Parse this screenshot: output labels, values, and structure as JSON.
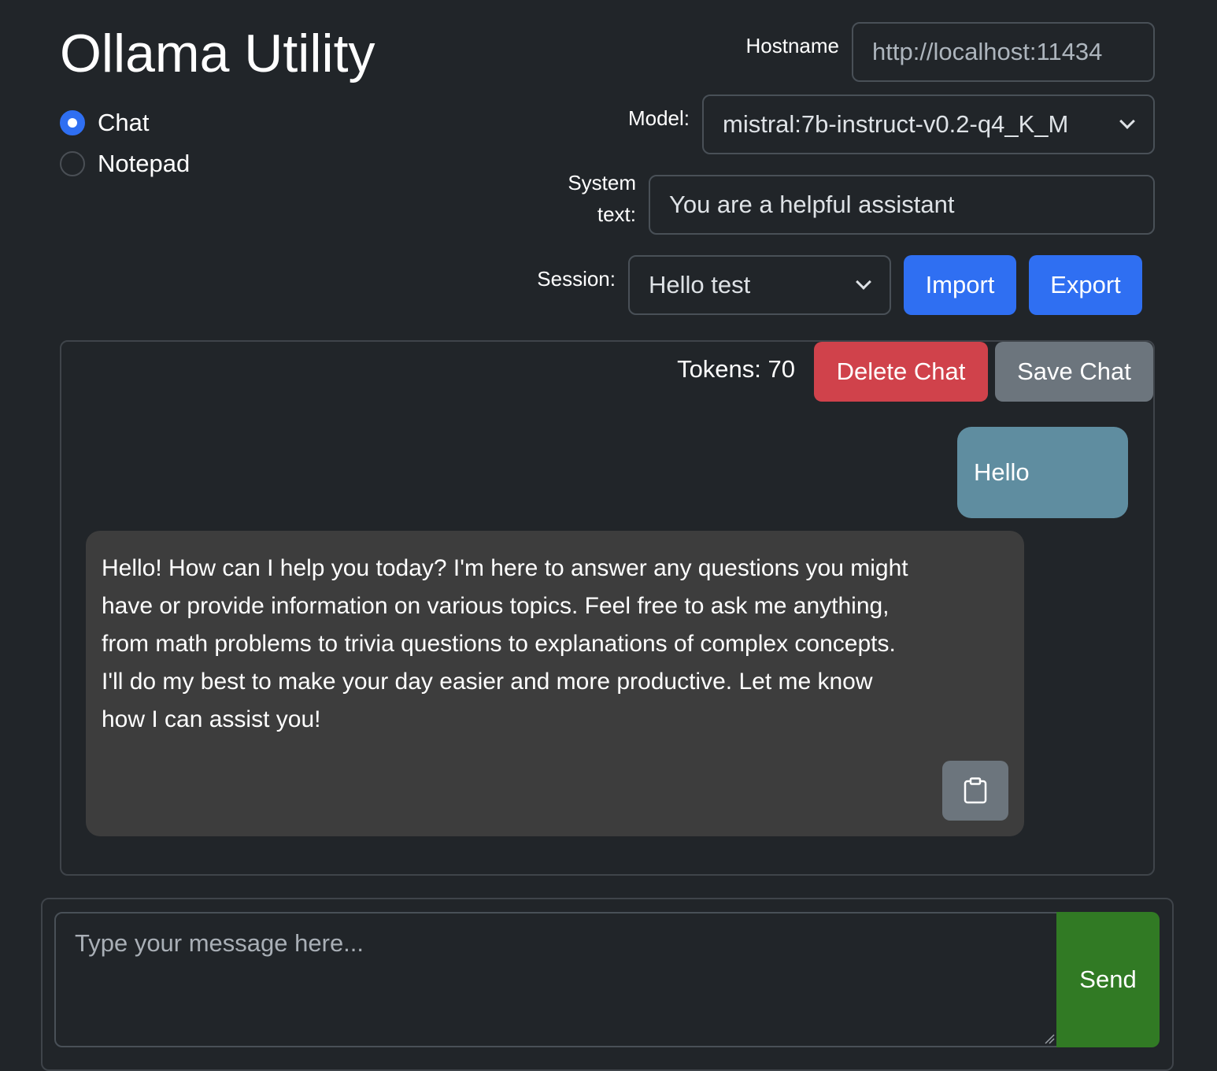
{
  "header": {
    "title": "Ollama Utility"
  },
  "modes": [
    {
      "label": "Chat",
      "selected": true
    },
    {
      "label": "Notepad",
      "selected": false
    }
  ],
  "settings": {
    "hostname_label": "Hostname",
    "hostname_value": "http://localhost:11434",
    "model_label": "Model:",
    "model_value": "mistral:7b-instruct-v0.2-q4_K_M",
    "system_label_line1": "System",
    "system_label_line2": "text:",
    "system_value": "You are a helpful assistant",
    "session_label": "Session:",
    "session_value": "Hello test",
    "import_label": "Import",
    "export_label": "Export"
  },
  "chat": {
    "tokens_text": "Tokens: 70",
    "delete_label": "Delete Chat",
    "save_label": "Save Chat",
    "messages": [
      {
        "role": "user",
        "text": "Hello"
      },
      {
        "role": "assistant",
        "text": "Hello! How can I help you today? I'm here to answer any questions you might have or provide information on various topics. Feel free to ask me anything, from math problems to trivia questions to explanations of complex concepts. I'll do my best to make your day easier and more productive. Let me know how I can assist you!"
      }
    ],
    "copy_icon": "clipboard-icon"
  },
  "composer": {
    "placeholder": "Type your message here...",
    "value": "",
    "send_label": "Send"
  },
  "colors": {
    "background": "#212529",
    "primary": "#2f6ff2",
    "danger": "#d0424b",
    "secondary": "#6c757d",
    "success": "#317a24",
    "user_bubble": "#5f8da0",
    "assistant_bubble": "#3d3d3d"
  }
}
